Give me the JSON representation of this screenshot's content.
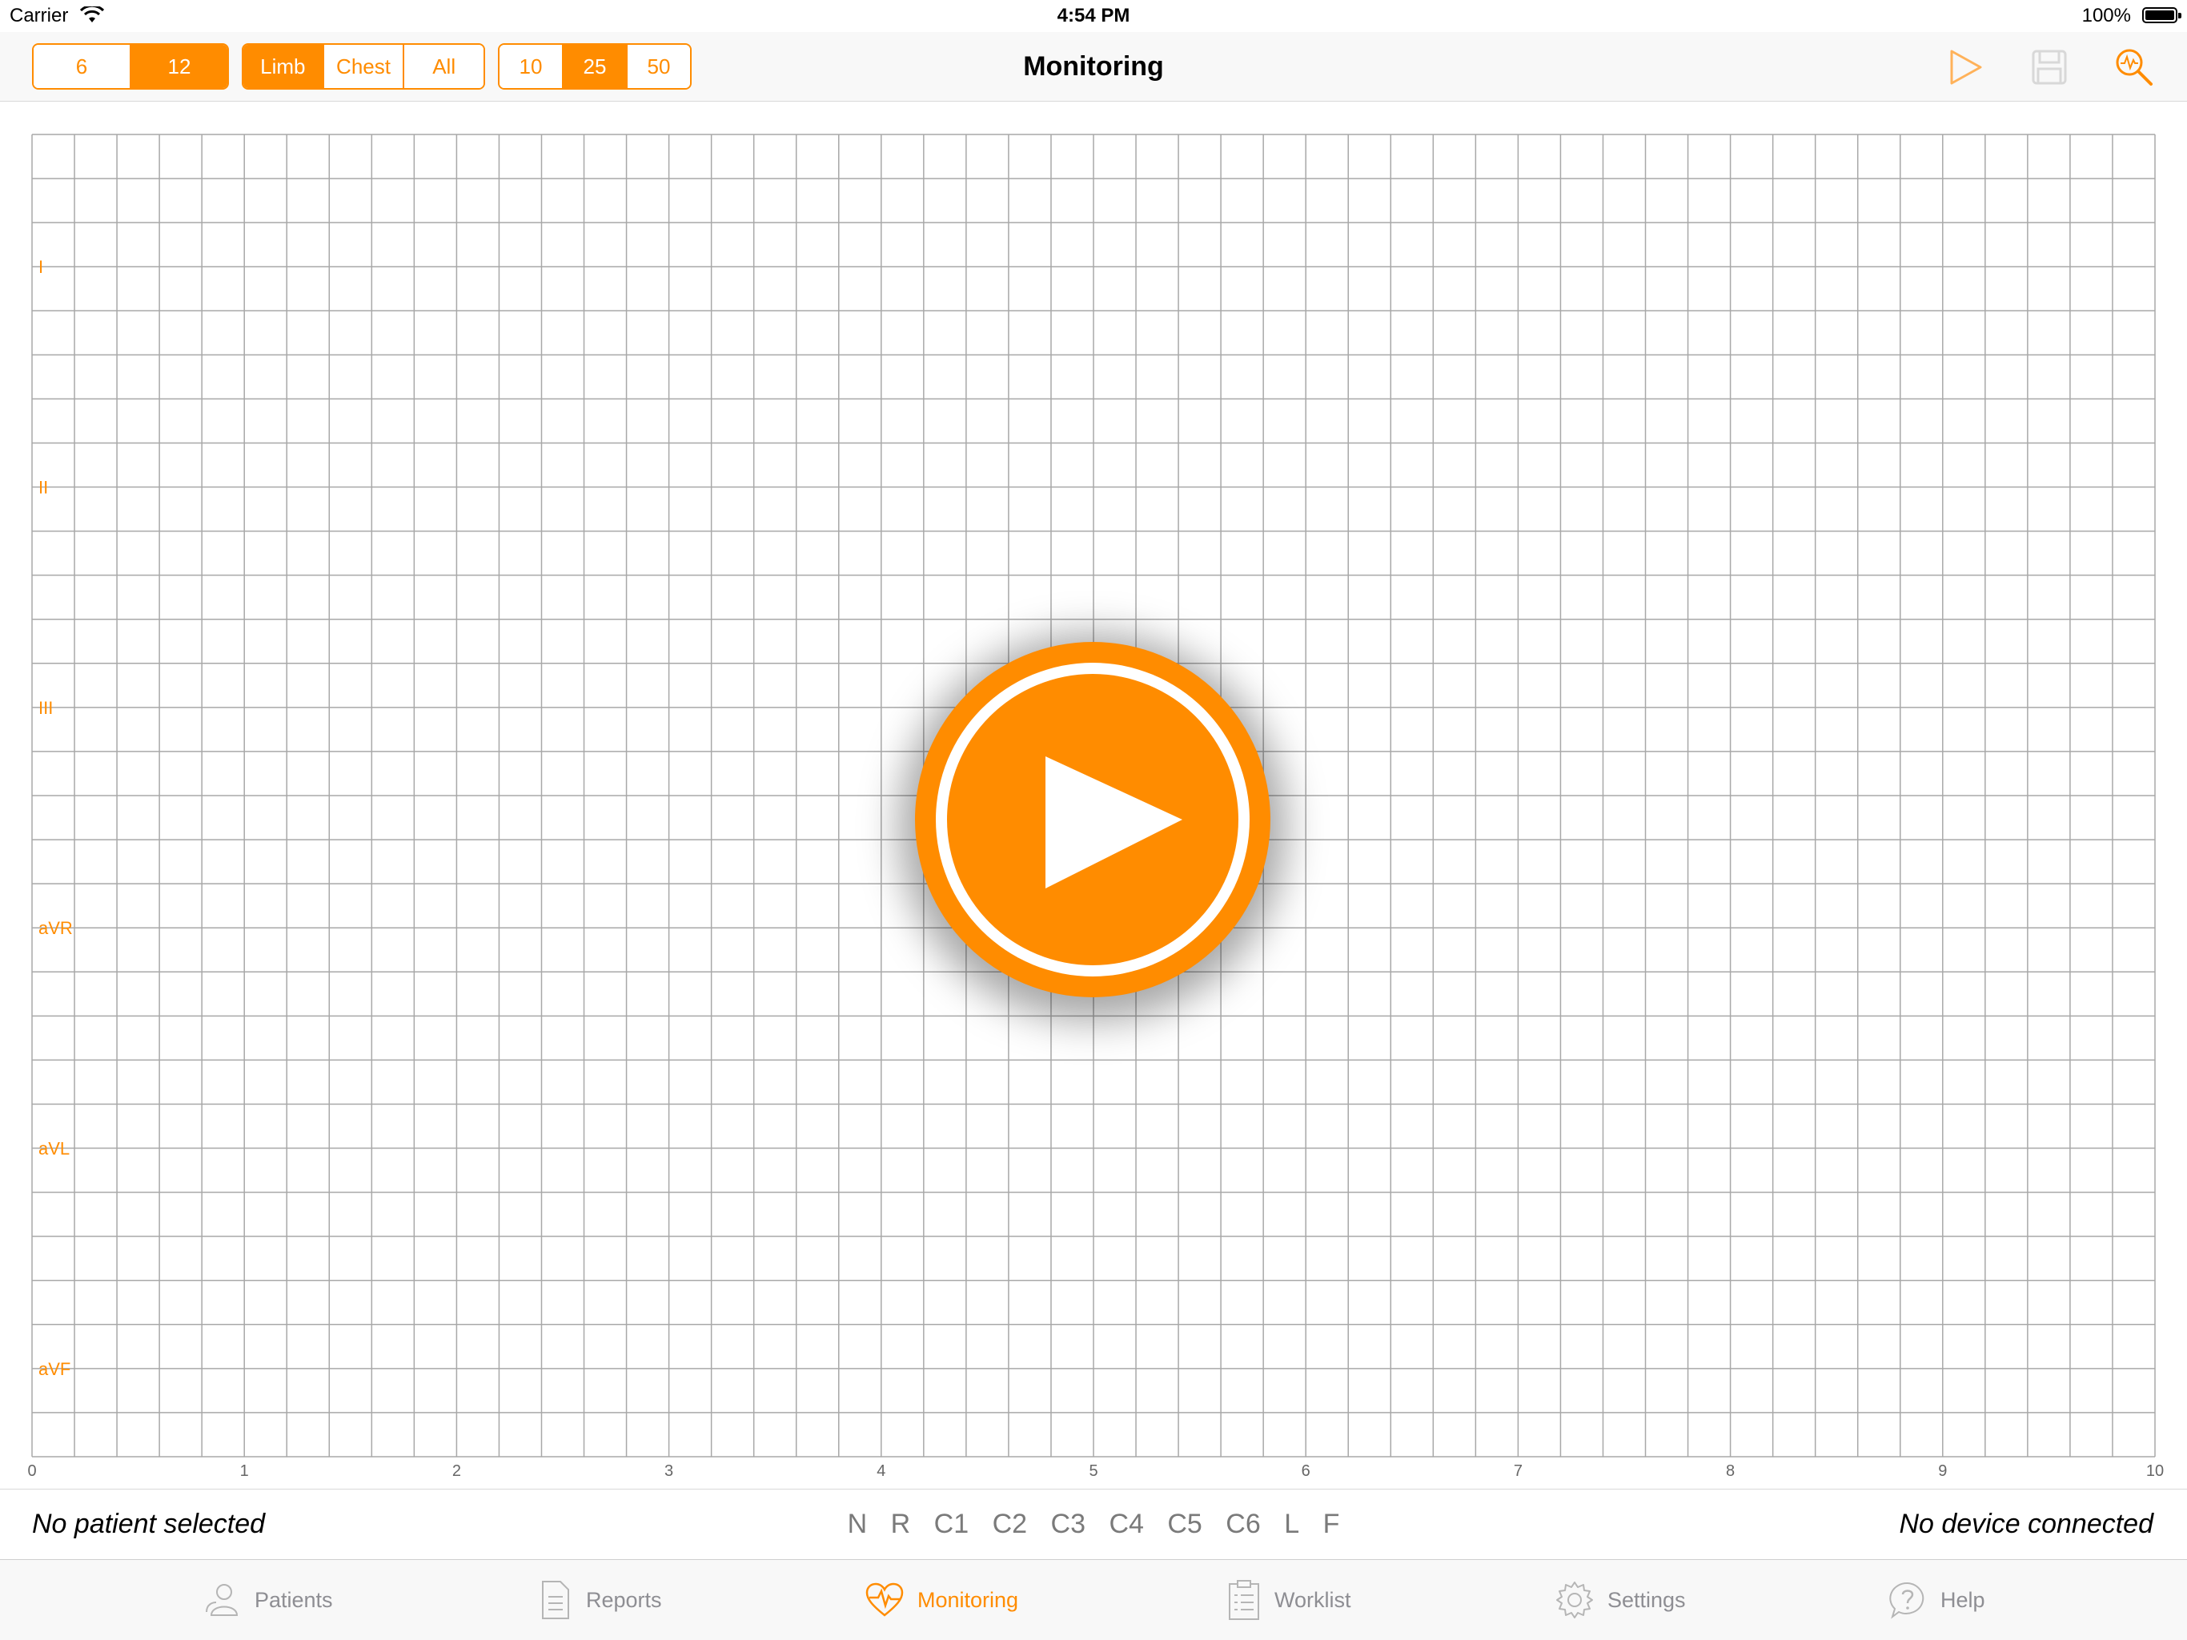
{
  "status_bar": {
    "carrier": "Carrier",
    "time": "4:54 PM",
    "battery": "100%"
  },
  "nav": {
    "title": "Monitoring",
    "lead_count": {
      "options": [
        "6",
        "12"
      ],
      "selected": "12"
    },
    "lead_group": {
      "options": [
        "Limb",
        "Chest",
        "All"
      ],
      "selected": "Limb"
    },
    "speed": {
      "options": [
        "10",
        "25",
        "50"
      ],
      "selected": "25"
    },
    "icons": [
      "play-outline-icon",
      "save-disk-icon",
      "ecg-search-icon"
    ]
  },
  "ecg": {
    "leads": [
      "I",
      "II",
      "III",
      "aVR",
      "aVL",
      "aVF"
    ],
    "x_ticks": [
      "0",
      "1",
      "2",
      "3",
      "4",
      "5",
      "6",
      "7",
      "8",
      "9",
      "10"
    ],
    "grid_columns": 50,
    "grid_rows": 30
  },
  "big_play_icon": "play-icon",
  "info": {
    "patient": "No patient selected",
    "device": "No device connected",
    "electrodes": [
      "N",
      "R",
      "C1",
      "C2",
      "C3",
      "C4",
      "C5",
      "C6",
      "L",
      "F"
    ]
  },
  "tabs": [
    {
      "label": "Patients",
      "icon": "patients-icon"
    },
    {
      "label": "Reports",
      "icon": "reports-icon"
    },
    {
      "label": "Monitoring",
      "icon": "heart-monitor-icon",
      "active": true
    },
    {
      "label": "Worklist",
      "icon": "worklist-icon"
    },
    {
      "label": "Settings",
      "icon": "gear-icon"
    },
    {
      "label": "Help",
      "icon": "help-icon"
    }
  ],
  "colors": {
    "accent": "#ff8c00",
    "grid": "#a8a8a8",
    "inactive": "#8e8e93"
  }
}
